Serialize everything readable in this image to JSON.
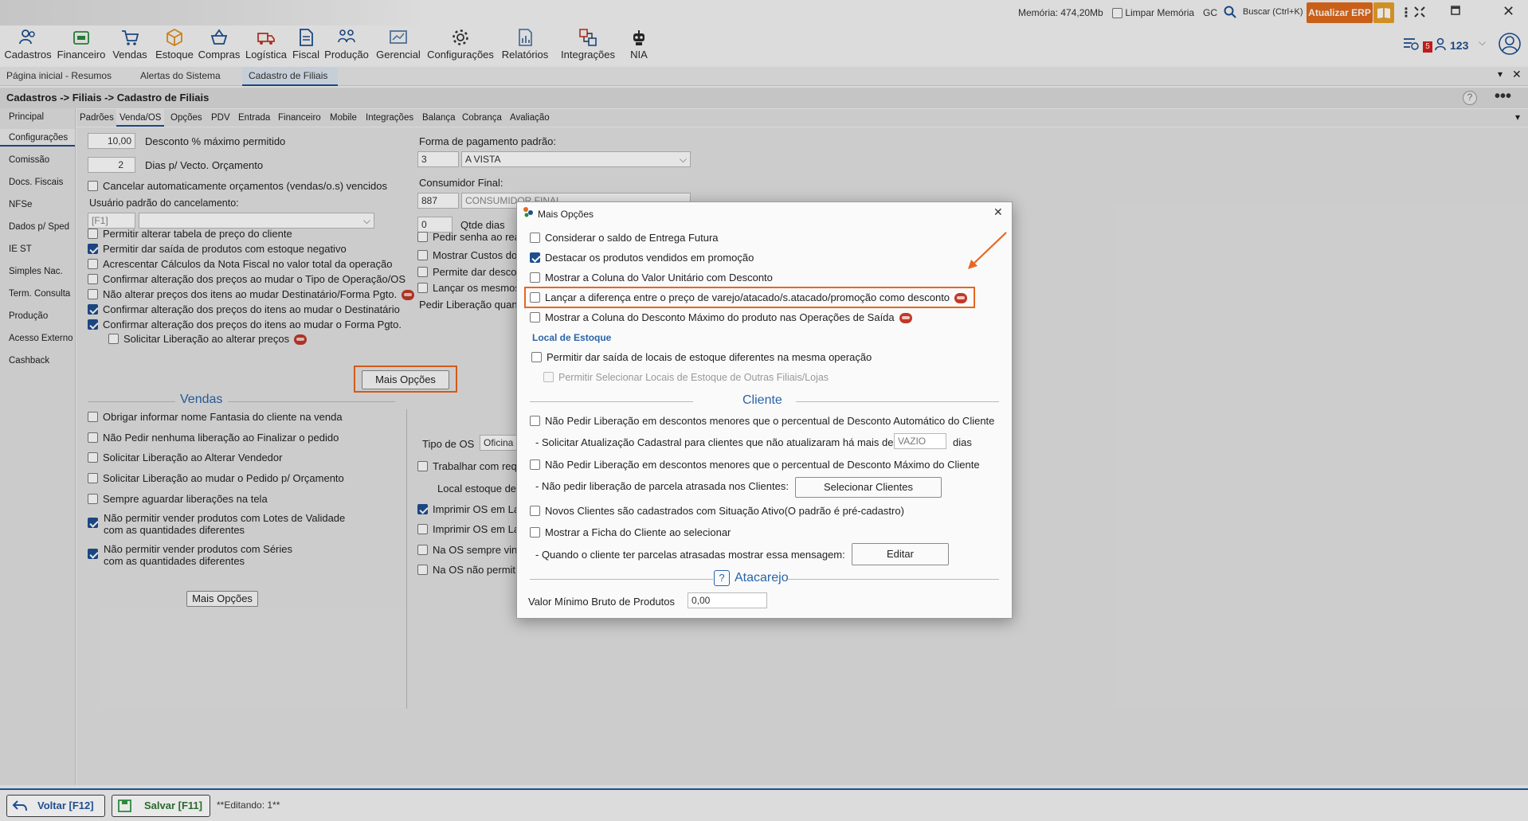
{
  "titlebar": {
    "memoria": "Memória: 474,20Mb",
    "limpar_memoria": "Limpar Memória",
    "gc": "GC",
    "buscar": "Buscar (Ctrl+K)",
    "atualizar_erp": "Atualizar ERP"
  },
  "ribbon": [
    {
      "label": "Cadastros",
      "icon": "users-icon"
    },
    {
      "label": "Financeiro",
      "icon": "money-icon"
    },
    {
      "label": "Vendas",
      "icon": "cart-icon"
    },
    {
      "label": "Estoque",
      "icon": "box-icon"
    },
    {
      "label": "Compras",
      "icon": "basket-icon"
    },
    {
      "label": "Logística",
      "icon": "truck-icon"
    },
    {
      "label": "Fiscal",
      "icon": "document-icon"
    },
    {
      "label": "Produção",
      "icon": "production-icon"
    },
    {
      "label": "Gerencial",
      "icon": "dashboard-icon"
    },
    {
      "label": "Configurações",
      "icon": "gear-icon"
    },
    {
      "label": "Relatórios",
      "icon": "report-icon"
    },
    {
      "label": "Integrações",
      "icon": "integration-icon"
    },
    {
      "label": "NIA",
      "icon": "robot-icon"
    }
  ],
  "notifications": {
    "badge": "5",
    "count": "123"
  },
  "page_tabs": [
    "Página inicial - Resumos",
    "Alertas do Sistema",
    "Cadastro de Filiais"
  ],
  "breadcrumb": "Cadastros -> Filiais -> Cadastro de Filiais",
  "left_nav": [
    "Principal",
    "Configurações",
    "Comissão",
    "Docs. Fiscais",
    "NFSe",
    "Dados p/ Sped",
    "IE ST",
    "Simples Nac.",
    "Term. Consulta",
    "Produção",
    "Acesso Externo",
    "Cashback"
  ],
  "sub_tabs": [
    "Padrões",
    "Venda/OS",
    "Opções",
    "PDV",
    "Entrada",
    "Financeiro",
    "Mobile",
    "Integrações",
    "Balança",
    "Cobrança",
    "Avaliação"
  ],
  "form": {
    "desconto_value": "10,00",
    "desconto_label": "Desconto % máximo permitido",
    "dias_value": "2",
    "dias_label": "Dias p/ Vecto. Orçamento",
    "cancelar_label": "Cancelar automaticamente orçamentos (vendas/o.s) vencidos",
    "usuario_label": "Usuário padrão do cancelamento:",
    "usuario_code": "[F1]",
    "forma_label": "Forma de pagamento padrão:",
    "forma_code": "3",
    "forma_value": "A VISTA",
    "consumidor_label": "Consumidor Final:",
    "consumidor_code": "887",
    "consumidor_value": "CONSUMIDOR FINAL",
    "qtde_value": "0",
    "qtde_label": "Qtde dias",
    "checks_left": [
      {
        "label": "Permitir alterar tabela de preço do cliente",
        "checked": false
      },
      {
        "label": "Permitir dar saída de produtos com estoque negativo",
        "checked": true
      },
      {
        "label": "Acrescentar Cálculos da Nota Fiscal no valor total da operação",
        "checked": false
      },
      {
        "label": "Confirmar alteração dos preços ao mudar o Tipo de Operação/OS",
        "checked": false
      },
      {
        "label": "Não alterar preços dos itens ao mudar Destinatário/Forma Pgto.",
        "checked": false
      },
      {
        "label": "Confirmar alteração dos preços do itens ao mudar o Destinatário",
        "checked": true
      },
      {
        "label": "Confirmar alteração dos preços do itens ao mudar o Forma Pgto.",
        "checked": true
      }
    ],
    "solicitar_lib_precos": "Solicitar Liberação ao alterar preços",
    "checks_right": [
      "Pedir senha ao rea",
      "Mostrar Custos do",
      "Permite dar desco",
      "Lançar os mesmos"
    ],
    "pedir_liberacao": "Pedir Liberação quan",
    "mais_opcoes_1": "Mais Opções",
    "vendas_title": "Vendas",
    "vendas_checks": [
      {
        "label": "Obrigar informar nome Fantasia do cliente na venda",
        "checked": false
      },
      {
        "label": "Não Pedir nenhuma liberação ao Finalizar o pedido",
        "checked": false
      },
      {
        "label": "Solicitar Liberação ao Alterar Vendedor",
        "checked": false
      },
      {
        "label": "Solicitar Liberação ao mudar o Pedido p/ Orçamento",
        "checked": false
      },
      {
        "label": "Sempre aguardar liberações na tela",
        "checked": false
      }
    ],
    "lotes_l1": "Não permitir vender produtos com Lotes de Validade",
    "lotes_l2": "com as quantidades diferentes",
    "series_l1": "Não permitir vender produtos com Séries",
    "series_l2": "com as quantidades diferentes",
    "mais_opcoes_2": "Mais Opções",
    "tipo_os_label": "Tipo de OS",
    "tipo_os_value": "Oficina",
    "os_checks": [
      {
        "label": "Trabalhar com req",
        "checked": false
      },
      {
        "label": "Imprimir OS em La",
        "checked": true
      },
      {
        "label": "Imprimir OS em La",
        "checked": false
      },
      {
        "label": "Na OS sempre vin",
        "checked": false
      },
      {
        "label": "Na OS não permit",
        "checked": false
      }
    ],
    "local_estoque": "Local estoque de"
  },
  "dialog": {
    "title": "Mais Opções",
    "checks": [
      {
        "label": "Considerar o saldo de Entrega Futura",
        "checked": false
      },
      {
        "label": "Destacar os produtos vendidos em promoção",
        "checked": true
      },
      {
        "label": "Mostrar a Coluna do Valor Unitário com Desconto",
        "checked": false
      },
      {
        "label": "Lançar a diferença entre o preço de varejo/atacado/s.atacado/promoção como desconto",
        "checked": false
      },
      {
        "label": "Mostrar a Coluna do Desconto Máximo do produto nas Operações de Saída",
        "checked": false
      }
    ],
    "local_estoque_title": "Local de Estoque",
    "permitir_locais": "Permitir dar saída de locais de estoque diferentes na mesma operação",
    "permitir_outras": "Permitir Selecionar Locais de Estoque de Outras Filiais/Lojas",
    "cliente_title": "Cliente",
    "nao_pedir_auto": "Não Pedir Liberação em descontos menores que o percentual de Desconto Automático do Cliente",
    "solicitar_atualizacao": "- Solicitar Atualização Cadastral para clientes que não atualizaram há mais de",
    "vazio": "VAZIO",
    "dias": "dias",
    "nao_pedir_max": "Não Pedir Liberação em descontos menores que o percentual de Desconto Máximo do Cliente",
    "nao_pedir_parcela": "- Não pedir liberação de parcela atrasada nos Clientes:",
    "selecionar_clientes": "Selecionar Clientes",
    "novos_clientes": "Novos Clientes são cadastrados com Situação Ativo(O padrão é pré-cadastro)",
    "mostrar_ficha": "Mostrar a Ficha do Cliente ao selecionar",
    "parcelas_msg": "- Quando o cliente ter parcelas atrasadas mostrar essa mensagem:",
    "editar": "Editar",
    "atacarejo_title": "Atacarejo",
    "valor_minimo_label": "Valor Mínimo Bruto de Produtos",
    "valor_minimo_value": "0,00"
  },
  "bottombar": {
    "voltar": "Voltar [F12]",
    "salvar": "Salvar [F11]",
    "editando": "**Editando: 1**"
  },
  "colors": {
    "accent": "#1f4f8f",
    "highlight": "#e8661f",
    "section": "#2a64a8"
  }
}
